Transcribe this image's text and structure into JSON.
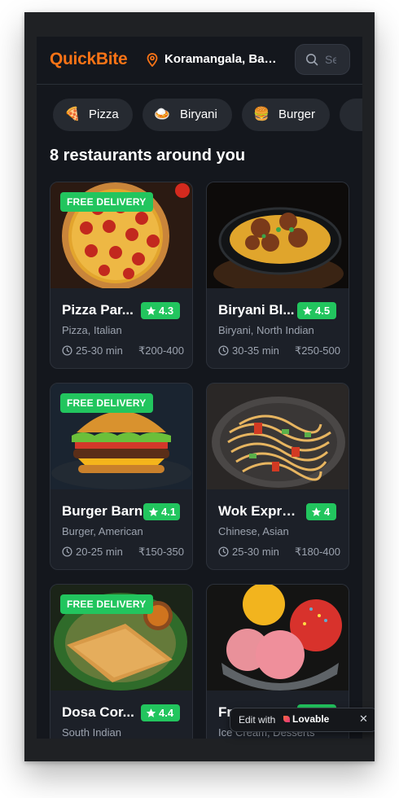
{
  "header": {
    "logo": "QuickBite",
    "location": "Koramangala, Ban...",
    "search_placeholder": "Se"
  },
  "categories": [
    {
      "emoji": "🍕",
      "label": "Pizza"
    },
    {
      "emoji": "🍛",
      "label": "Biryani"
    },
    {
      "emoji": "🍔",
      "label": "Burger"
    }
  ],
  "section_title": "8 restaurants around you",
  "restaurants": [
    {
      "name": "Pizza Par...",
      "rating": "4.3",
      "cuisine": "Pizza, Italian",
      "time": "25-30 min",
      "price": "₹200-400",
      "badge": "FREE DELIVERY"
    },
    {
      "name": "Biryani Bl...",
      "rating": "4.5",
      "cuisine": "Biryani, North Indian",
      "time": "30-35 min",
      "price": "₹250-500",
      "badge": ""
    },
    {
      "name": "Burger Barn",
      "rating": "4.1",
      "cuisine": "Burger, American",
      "time": "20-25 min",
      "price": "₹150-350",
      "badge": "FREE DELIVERY"
    },
    {
      "name": "Wok Express",
      "rating": "4",
      "cuisine": "Chinese, Asian",
      "time": "25-30 min",
      "price": "₹180-400",
      "badge": ""
    },
    {
      "name": "Dosa Cor...",
      "rating": "4.4",
      "cuisine": "South Indian",
      "time": "",
      "price": "",
      "badge": "FREE DELIVERY"
    },
    {
      "name": "Fr...",
      "rating": "",
      "cuisine": "Ice Cream, Desserts",
      "time": "",
      "price": "",
      "badge": ""
    }
  ],
  "lovable": {
    "prefix": "Edit with",
    "brand": "Lovable",
    "close": "✕"
  },
  "colors": {
    "accent": "#f97316",
    "rating_bg": "#22c55e",
    "background": "#14171d",
    "card": "#1c2028"
  }
}
